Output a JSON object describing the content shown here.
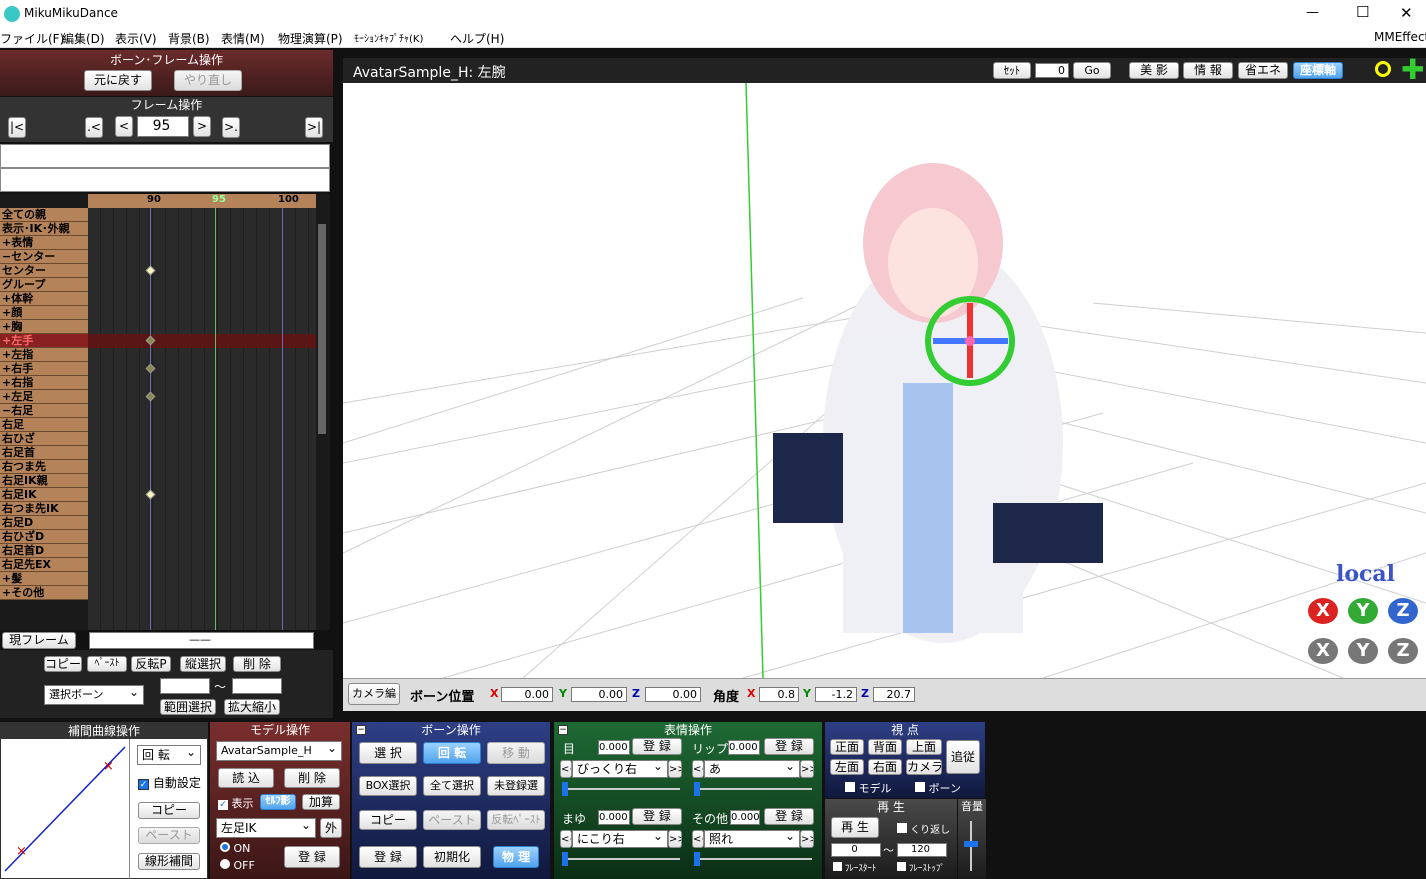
{
  "title": "MikuMikuDance",
  "window_controls": {
    "minimize": "—",
    "maximize": "☐",
    "close": "✕"
  },
  "menu": [
    "ファイル(F)",
    "編集(D)",
    "表示(V)",
    "背景(B)",
    "表情(M)",
    "物理演算(P)",
    "ﾓｰｼｮﾝｷｬﾌﾟﾁｬ(K)",
    "ヘルプ(H)"
  ],
  "mmeffect": "MMEffect",
  "bone_frame": {
    "title": "ボーン･フレーム操作",
    "undo": "元に戻す",
    "redo": "やり直し"
  },
  "frame_ops": {
    "title": "フレーム操作",
    "first": "|<",
    "prev_key": ".<",
    "prev": "<",
    "frame": "95",
    "next": ">",
    "next_key": ">.",
    "last": ">|"
  },
  "timeline": {
    "ticks": [
      "90",
      "95",
      "100"
    ],
    "rows": [
      "全ての親",
      "表示･IK･外親",
      "+表情",
      "−センター",
      "センター",
      "グループ",
      "+体幹",
      "+顔",
      "+胸",
      "+左手",
      "+左指",
      "+右手",
      "+右指",
      "+左足",
      "−右足",
      "右足",
      "右ひざ",
      "右足首",
      "右つま先",
      "右足IK親",
      "右足IK",
      "右つま先IK",
      "右足D",
      "右ひざD",
      "右足首D",
      "右足先EX",
      "+髪",
      "+その他"
    ]
  },
  "current_frame": {
    "label": "現フレーム",
    "value": "——"
  },
  "edit_buttons": {
    "copy": "コピー",
    "paste": "ﾍﾟｰｽﾄ",
    "flip": "反転P",
    "vsel": "縦選択",
    "del": "削 除",
    "range_sel": "範囲選択",
    "zoom": "拡大縮小",
    "tilde": "～",
    "select_bone": "選択ボーン"
  },
  "viewport": {
    "title": "AvatarSample_H: 左腕",
    "set": "ｾｯﾄ",
    "set_value": "0",
    "go": "Go",
    "btn1": "美 影",
    "btn2": "情 報",
    "btn3": "省エネ",
    "btn4": "座標軸",
    "local": "local",
    "axis_x": "X",
    "axis_y": "Y",
    "axis_z": "Z"
  },
  "vpbar": {
    "camera": "カメラ編",
    "pos_label": "ボーン位置",
    "x": "0.00",
    "y": "0.00",
    "z": "0.00",
    "ang_label": "角度",
    "ax": "0.8",
    "ay": "-1.2",
    "az": "20.7"
  },
  "interp": {
    "title": "補間曲線操作",
    "sel": "回 転",
    "auto": "自動設定",
    "copy": "コピー",
    "paste": "ペースト",
    "linear": "線形補間"
  },
  "model": {
    "title": "モデル操作",
    "model": "AvatarSample_H",
    "load": "読 込",
    "del": "削 除",
    "display": "表示",
    "self_shadow": "ｾﾙﾌ影",
    "add": "加算",
    "bone": "左足IK",
    "outer": "外",
    "on": "ON",
    "off": "OFF",
    "register": "登 録"
  },
  "bone_ops": {
    "title": "ボーン操作",
    "select": "選 択",
    "rotate": "回 転",
    "move": "移 動",
    "box": "BOX選択",
    "all": "全て選択",
    "unreg": "未登録選",
    "copy": "コピー",
    "paste": "ペースト",
    "flip": "反転ﾍﾟｰｽﾄ",
    "register": "登 録",
    "init": "初期化",
    "physics": "物 理"
  },
  "face": {
    "title": "表情操作",
    "eye": "目",
    "lip": "リップ",
    "brow": "まゆ",
    "other": "その他",
    "v": "0.000",
    "register": "登 録",
    "eye_sel": "びっくり右",
    "lip_sel": "あ",
    "brow_sel": "にこり右",
    "other_sel": "照れ"
  },
  "view": {
    "title": "視 点",
    "front": "正面",
    "back": "背面",
    "top": "上面",
    "left": "左面",
    "right": "右面",
    "camera": "カメラ",
    "follow": "追従",
    "model": "モデル",
    "bone": "ボーン"
  },
  "play": {
    "title": "再 生",
    "play": "再 生",
    "loop": "くり返し",
    "from": "0",
    "to": "120",
    "tilde": "～",
    "fstart": "ﾌﾚｰｽﾀｰﾄ",
    "fstop": "ﾌﾚｰｽﾄｯﾌﾟ"
  },
  "volume": {
    "title": "音量"
  }
}
